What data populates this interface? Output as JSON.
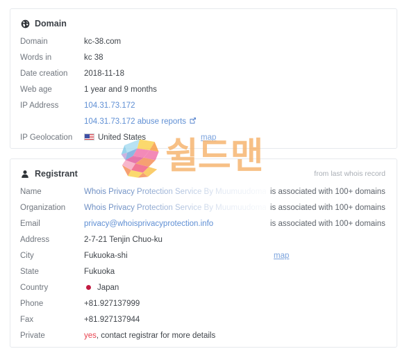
{
  "domain_card": {
    "icon": "globe-icon",
    "title": "Domain",
    "rows": [
      {
        "label": "Domain",
        "value": "kc-38.com"
      },
      {
        "label": "Words in",
        "value": "kc 38"
      },
      {
        "label": "Date creation",
        "value": "2018-11-18"
      },
      {
        "label": "Web age",
        "value": "1 year and 9 months"
      },
      {
        "label": "IP Address",
        "value": "104.31.73.172"
      }
    ],
    "ip_abuse_link": "104.31.73.172 abuse reports",
    "ip_abuse_icon": "external-link-icon",
    "geolocation_label": "IP Geolocation",
    "geolocation_value": "United States",
    "geolocation_flag": "flag-united-states-icon",
    "geolocation_map_link": "map"
  },
  "registrant_card": {
    "icon": "user-icon",
    "title": "Registrant",
    "note": "from last whois record",
    "name_label": "Name",
    "name_value": "Whois Privacy Protection Service By Muumuudomain",
    "name_assoc": "is associated with 100+ domains",
    "organization_label": "Organization",
    "organization_value": "Whois Privacy Protection Service By Muumuudomain",
    "organization_assoc": "is associated with 100+ domains",
    "email_label": "Email",
    "email_value": "privacy@whoisprivacyprotection.info",
    "email_assoc": "is associated with 100+ domains",
    "address_label": "Address",
    "address_value": "2-7-21 Tenjin Chuo-ku",
    "city_label": "City",
    "city_value": "Fukuoka-shi",
    "city_map_link": "map",
    "state_label": "State",
    "state_value": "Fukuoka",
    "country_label": "Country",
    "country_value": "Japan",
    "country_flag": "flag-japan-icon",
    "phone_label": "Phone",
    "phone_value": "+81.927137999",
    "fax_label": "Fax",
    "fax_value": "+81.927137944",
    "private_label": "Private",
    "private_value_highlight": "yes",
    "private_value_rest": ", contact registrar for more details"
  },
  "watermark": {
    "logo_mark": "low-poly-s-logo",
    "text": "쉴드맨"
  },
  "colors": {
    "link": "#5f8fd4",
    "muted_link": "#7ba3dd",
    "label": "#70767e",
    "value": "#3f444a",
    "border": "#e6e9ed",
    "alert": "#e8434f",
    "watermark_text": "#f6b26b"
  }
}
